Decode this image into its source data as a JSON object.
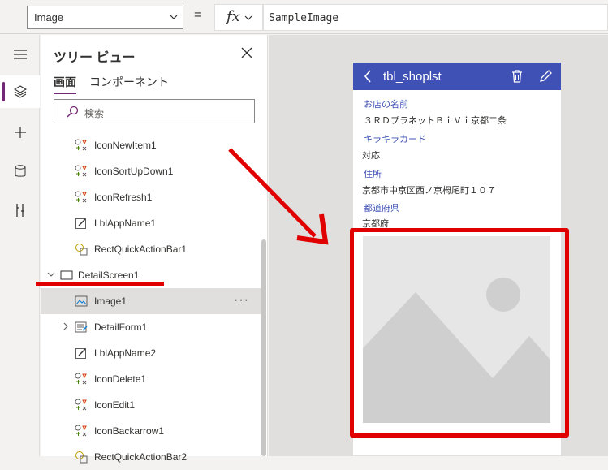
{
  "formula_bar": {
    "property": "Image",
    "equals": "=",
    "fx": "fx",
    "formula": "SampleImage"
  },
  "rail": {
    "items": [
      "hamburger-icon",
      "layers-icon",
      "add-icon",
      "database-icon",
      "tools-icon"
    ]
  },
  "tree": {
    "title": "ツリー ビュー",
    "tabs": [
      "画面",
      "コンポーネント"
    ],
    "search_placeholder": "検索",
    "rows": [
      {
        "label": "IconNewItem1"
      },
      {
        "label": "IconSortUpDown1"
      },
      {
        "label": "IconRefresh1"
      },
      {
        "label": "LblAppName1"
      },
      {
        "label": "RectQuickActionBar1"
      },
      {
        "label": "DetailScreen1"
      },
      {
        "label": "Image1",
        "more": "···"
      },
      {
        "label": "DetailForm1"
      },
      {
        "label": "LblAppName2"
      },
      {
        "label": "IconDelete1"
      },
      {
        "label": "IconEdit1"
      },
      {
        "label": "IconBackarrow1"
      },
      {
        "label": "RectQuickActionBar2"
      }
    ]
  },
  "preview": {
    "title": "tbl_shoplst",
    "fields": [
      {
        "label": "お店の名前",
        "value": "３ＲＤプラネットＢｉＶｉ京都二条"
      },
      {
        "label": "キラキラカード",
        "value": "対応"
      },
      {
        "label": "住所",
        "value": "京都市中京区西ノ京栂尾町１０７"
      },
      {
        "label": "都道府県",
        "value": "京都府"
      }
    ]
  },
  "colors": {
    "accent": "#742774",
    "header": "#3f51b5",
    "annotation": "#e00000"
  }
}
